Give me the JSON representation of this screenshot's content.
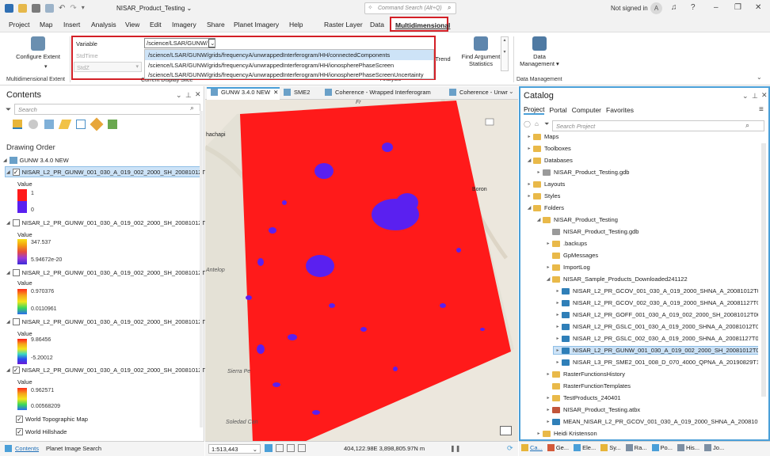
{
  "titlebar": {
    "project_title": "NISAR_Product_Testing",
    "command_search_placeholder": "Command Search (Alt+Q)",
    "signin": "Not signed in",
    "avatar": "A",
    "help": "?",
    "minimize": "–",
    "restore": "❐",
    "close": "✕"
  },
  "menus": [
    "Project",
    "Map",
    "Insert",
    "Analysis",
    "View",
    "Edit",
    "Imagery",
    "Share",
    "Planet Imagery",
    "Help",
    "Raster Layer",
    "Data",
    "Multidimensional"
  ],
  "ribbon": {
    "configure_extent": "Configure Extent",
    "configure_extent_caret": "▾",
    "group_multidimensional_extent": "Multidimensional Extent",
    "variable_label": "Variable",
    "variable_value": "/science/LSAR/GUNW/",
    "stdtime_label": "StdTime",
    "stdz_label": "StdZ",
    "group_current_display_slice": "Current Display Slice",
    "trend_label": "Trend",
    "find_argument": "Find Argument Statistics",
    "data_management": "Data Management",
    "group_data_management": "Data Management",
    "group_analysis": "Analysis",
    "dropdown_options": [
      "/science/LSAR/GUNW/grids/frequencyA/unwrappedInterferogram/HH/connectedComponents",
      "/science/LSAR/GUNW/grids/frequencyA/unwrappedInterferogram/HH/ionospherePhaseScreen",
      "/science/LSAR/GUNW/grids/frequencyA/unwrappedInterferogram/HH/ionospherePhaseScreenUncertainty"
    ]
  },
  "contents": {
    "title": "Contents",
    "search_placeholder": "Search",
    "drawing_order": "Drawing Order",
    "map_name": "GUNW 3.4.0 NEW",
    "value_label": "Value",
    "layers": [
      {
        "name": "NISAR_L2_PR_GUNW_001_030_A_019_002_2000_SH_20081012T0...",
        "checked": true,
        "max": "1",
        "min": "0"
      },
      {
        "name": "NISAR_L2_PR_GUNW_001_030_A_019_002_2000_SH_20081012T0...",
        "checked": false,
        "max": "347.537",
        "min": "5.94672e-20"
      },
      {
        "name": "NISAR_L2_PR_GUNW_001_030_A_019_002_2000_SH_20081012T0...",
        "checked": false,
        "max": "0.970376",
        "min": "0.0110961"
      },
      {
        "name": "NISAR_L2_PR_GUNW_001_030_A_019_002_2000_SH_20081012T0...",
        "checked": false,
        "max": "9.86456",
        "min": "-5.20012"
      },
      {
        "name": "NISAR_L2_PR_GUNW_001_030_A_019_002_2000_SH_20081012T0...",
        "checked": true,
        "max": "0.962571",
        "min": "0.00568209"
      }
    ],
    "basemap1": "World Topographic Map",
    "basemap2": "World Hillshade"
  },
  "map": {
    "tabs": [
      "GUNW 3.4.0 NEW",
      "SME2",
      "Coherence - Wrapped Interferogram",
      "Coherence - Unwr"
    ],
    "place_labels": [
      "hachapi",
      "Antelop",
      "Sierra Pe",
      "Soledad Can",
      "Boron",
      "Fr"
    ],
    "scale": "1:513,443",
    "coordinates": "404,122.98E 3,898,805.97N m"
  },
  "catalog": {
    "title": "Catalog",
    "tabs": [
      "Project",
      "Portal",
      "Computer",
      "Favorites"
    ],
    "search_placeholder": "Search Project",
    "items": [
      {
        "label": "Maps",
        "indent": 0,
        "icon": "folder",
        "caret": "▸"
      },
      {
        "label": "Toolboxes",
        "indent": 0,
        "icon": "folder",
        "caret": "▸"
      },
      {
        "label": "Databases",
        "indent": 0,
        "icon": "folder",
        "caret": "◢"
      },
      {
        "label": "NISAR_Product_Testing.gdb",
        "indent": 1,
        "icon": "gdb",
        "caret": "▸"
      },
      {
        "label": "Layouts",
        "indent": 0,
        "icon": "folder",
        "caret": "▸"
      },
      {
        "label": "Styles",
        "indent": 0,
        "icon": "folder",
        "caret": "▸"
      },
      {
        "label": "Folders",
        "indent": 0,
        "icon": "folder",
        "caret": "◢"
      },
      {
        "label": "NISAR_Product_Testing",
        "indent": 1,
        "icon": "folder",
        "caret": "◢"
      },
      {
        "label": "NISAR_Product_Testing.gdb",
        "indent": 2,
        "icon": "gdb",
        "caret": ""
      },
      {
        "label": ".backups",
        "indent": 2,
        "icon": "folder",
        "caret": "▸"
      },
      {
        "label": "GpMessages",
        "indent": 2,
        "icon": "folder",
        "caret": ""
      },
      {
        "label": "ImportLog",
        "indent": 2,
        "icon": "folder",
        "caret": "▸"
      },
      {
        "label": "NISAR_Sample_Products_Downloaded241122",
        "indent": 2,
        "icon": "folder",
        "caret": "◢"
      },
      {
        "label": "NISAR_L2_PR_GCOV_001_030_A_019_2000_SHNA_A_20081012T0609...",
        "indent": 3,
        "icon": "raster",
        "caret": "▸"
      },
      {
        "label": "NISAR_L2_PR_GCOV_002_030_A_019_2000_SHNA_A_20081127T0609...",
        "indent": 3,
        "icon": "raster",
        "caret": "▸"
      },
      {
        "label": "NISAR_L2_PR_GOFF_001_030_A_019_002_2000_SH_20081012T06091...",
        "indent": 3,
        "icon": "raster",
        "caret": "▸"
      },
      {
        "label": "NISAR_L2_PR_GSLC_001_030_A_019_2000_SHNA_A_20081012T0609...",
        "indent": 3,
        "icon": "raster",
        "caret": "▸"
      },
      {
        "label": "NISAR_L2_PR_GSLC_002_030_A_019_2000_SHNA_A_20081127T0609...",
        "indent": 3,
        "icon": "raster",
        "caret": "▸"
      },
      {
        "label": "NISAR_L2_PR_GUNW_001_030_A_019_002_2000_SH_20081012T0609...",
        "indent": 3,
        "icon": "raster",
        "caret": "▸",
        "selected": true
      },
      {
        "label": "NISAR_L3_PR_SME2_001_008_D_070_4000_QPNA_A_20190829T1807...",
        "indent": 3,
        "icon": "raster",
        "caret": "▸"
      },
      {
        "label": "RasterFunctionsHistory",
        "indent": 2,
        "icon": "folder",
        "caret": "▸"
      },
      {
        "label": "RasterFunctionTemplates",
        "indent": 2,
        "icon": "folder",
        "caret": ""
      },
      {
        "label": "TestProducts_240401",
        "indent": 2,
        "icon": "folder",
        "caret": "▸"
      },
      {
        "label": "NISAR_Product_Testing.atbx",
        "indent": 2,
        "icon": "tbx",
        "caret": "▸"
      },
      {
        "label": "MEAN_NISAR_L2_PR_GCOV_001_030_A_019_2000_SHNA_A_20081012T...",
        "indent": 2,
        "icon": "raster",
        "caret": "▸"
      },
      {
        "label": "Heidi Kristenson",
        "indent": 1,
        "icon": "folder",
        "caret": "▸"
      }
    ]
  },
  "bottom_tabs": {
    "left": [
      "Contents",
      "Planet Image Search"
    ],
    "right": [
      "Ca...",
      "Ge...",
      "Ele...",
      "Sy...",
      "Ra...",
      "Po...",
      "His...",
      "Jo..."
    ]
  },
  "colors": {
    "accent_red": "#d31f26",
    "catalog_border": "#4a9fd8",
    "raster_fill": "#ff1a1a",
    "raster_blob": "#5a20f0"
  }
}
